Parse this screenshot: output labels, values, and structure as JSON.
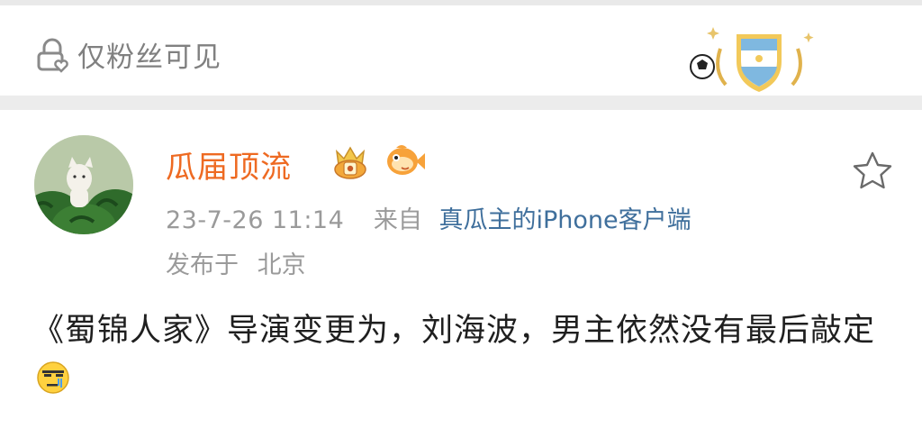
{
  "visibility": {
    "label": "仅粉丝可见",
    "icon": "lock-heart-icon"
  },
  "fan_badge": {
    "icon": "argentina-football-shield-icon",
    "colors": {
      "sky": "#7fb8e0",
      "gold": "#e8b84a"
    }
  },
  "post": {
    "author": {
      "name": "瓜届顶流",
      "name_color": "#ee6a22",
      "avatar": "watermelon-cat-avatar",
      "badges": [
        "crown-badge-icon",
        "fish-badge-icon"
      ]
    },
    "time": "23-7-26 11:14",
    "from_label": "来自",
    "source": "真瓜主的iPhone客户端",
    "source_color": "#3f6f9c",
    "location_prefix": "发布于",
    "location": "北京",
    "text": "《蜀锦人家》导演变更为，刘海波，男主依然没有最后敲定",
    "emoji": "speechless-emoji-icon",
    "favorite_icon": "star-outline-icon"
  }
}
